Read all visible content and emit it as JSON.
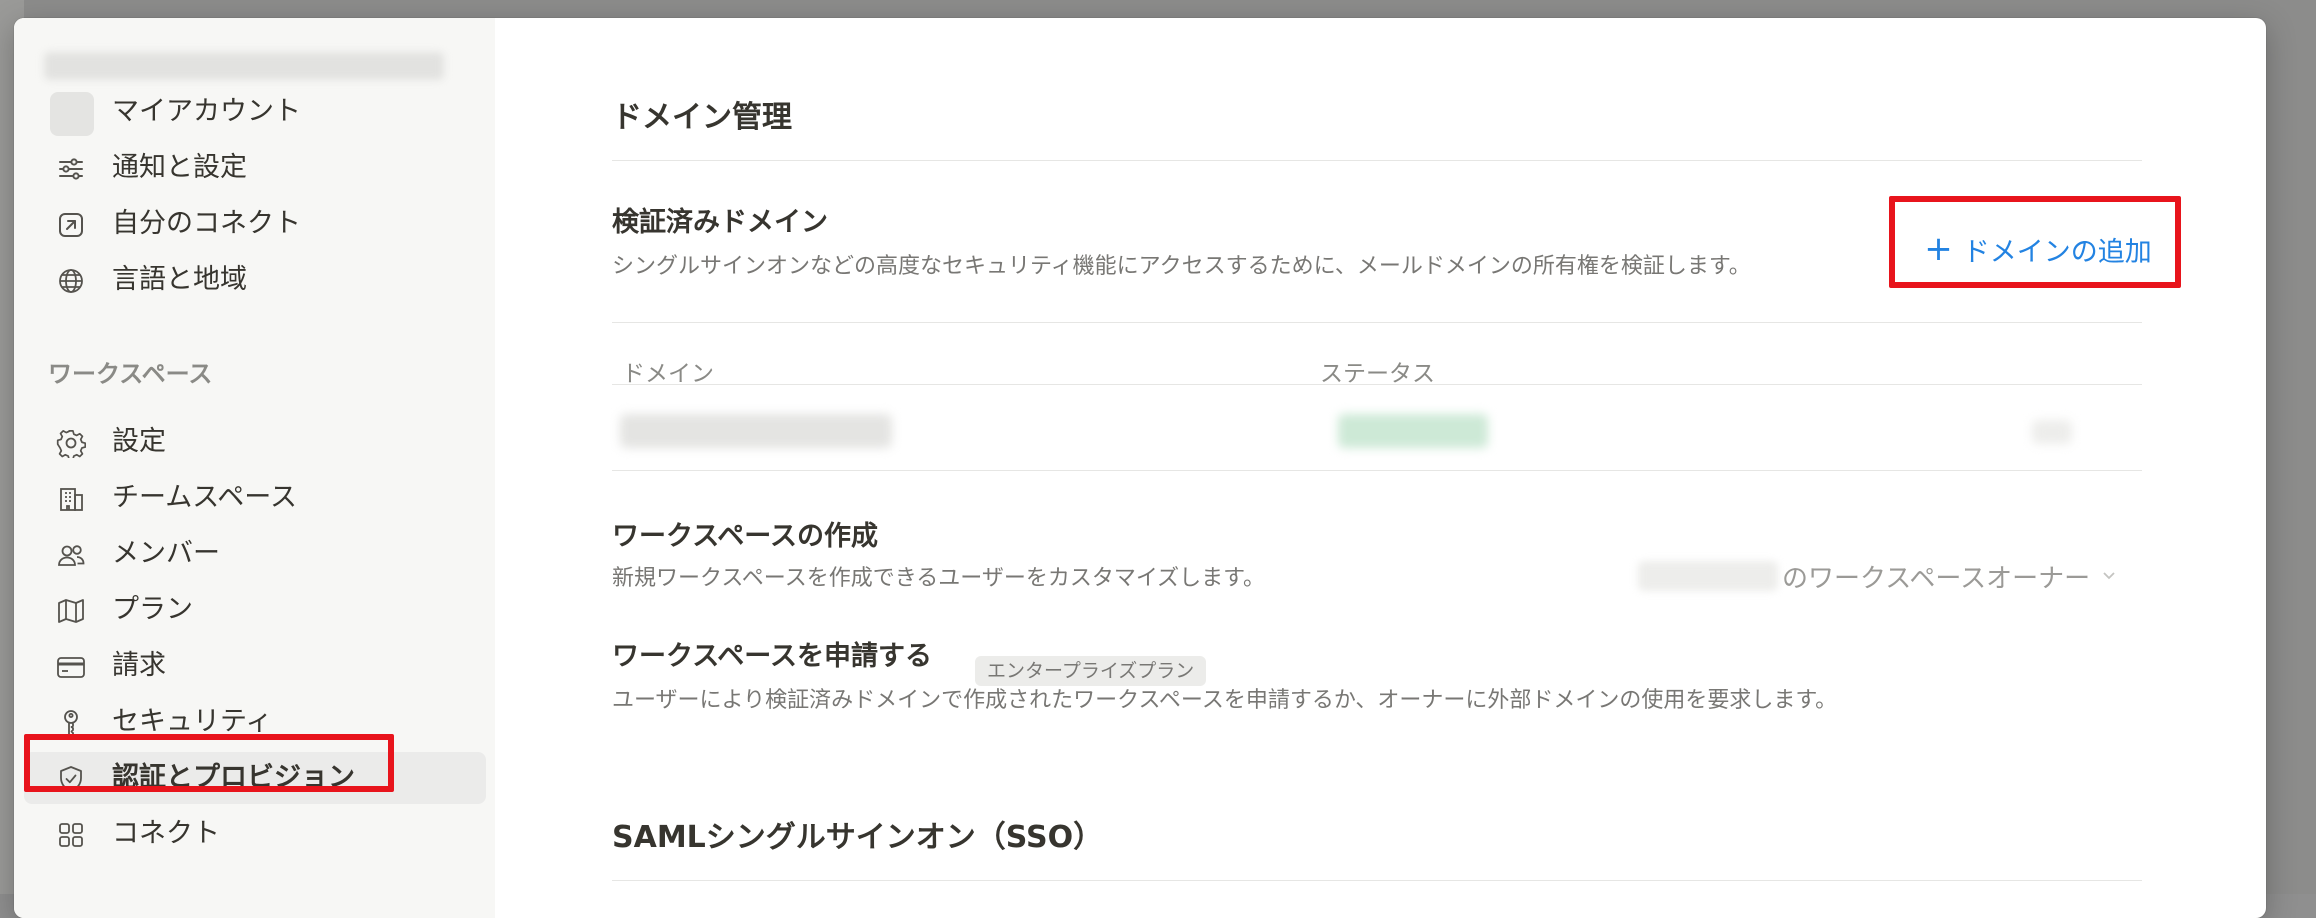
{
  "sidebar": {
    "account_item": {
      "label": "マイアカウント"
    },
    "personal_items": [
      {
        "label": "通知と設定",
        "icon": "sliders-icon"
      },
      {
        "label": "自分のコネクト",
        "icon": "arrow-up-right-square-icon"
      },
      {
        "label": "言語と地域",
        "icon": "globe-icon"
      }
    ],
    "workspace_section_label": "ワークスペース",
    "workspace_items": [
      {
        "label": "設定",
        "icon": "gear-icon"
      },
      {
        "label": "チームスペース",
        "icon": "building-icon"
      },
      {
        "label": "メンバー",
        "icon": "people-icon"
      },
      {
        "label": "プラン",
        "icon": "map-icon"
      },
      {
        "label": "請求",
        "icon": "credit-card-icon"
      },
      {
        "label": "セキュリティ",
        "icon": "key-icon"
      },
      {
        "label": "認証とプロビジョン",
        "icon": "shield-check-icon",
        "active": true
      },
      {
        "label": "コネクト",
        "icon": "grid-icon"
      }
    ]
  },
  "main": {
    "domain_section": {
      "title": "ドメイン管理",
      "verified_title": "検証済みドメイン",
      "verified_desc": "シングルサインオンなどの高度なセキュリティ機能にアクセスするために、メールドメインの所有権を検証します。",
      "add_button_label": "ドメインの追加",
      "table_headers": {
        "domain": "ドメイン",
        "status": "ステータス"
      }
    },
    "workspace_creation": {
      "title": "ワークスペースの作成",
      "desc": "新規ワークスペースを作成できるユーザーをカスタマイズします。",
      "select_value_suffix": "のワークスペースオーナー"
    },
    "workspace_claim": {
      "title": "ワークスペースを申請する",
      "badge": "エンタープライズプラン",
      "desc": "ユーザーにより検証済みドメインで作成されたワークスペースを申請するか、オーナーに外部ドメインの使用を要求します。"
    },
    "saml_section": {
      "title": "SAMLシングルサインオン（SSO）"
    }
  },
  "colors": {
    "accent": "#2383e2",
    "highlight": "#e8141c",
    "sidebar_bg": "#f7f7f5",
    "text": "#37352f"
  }
}
